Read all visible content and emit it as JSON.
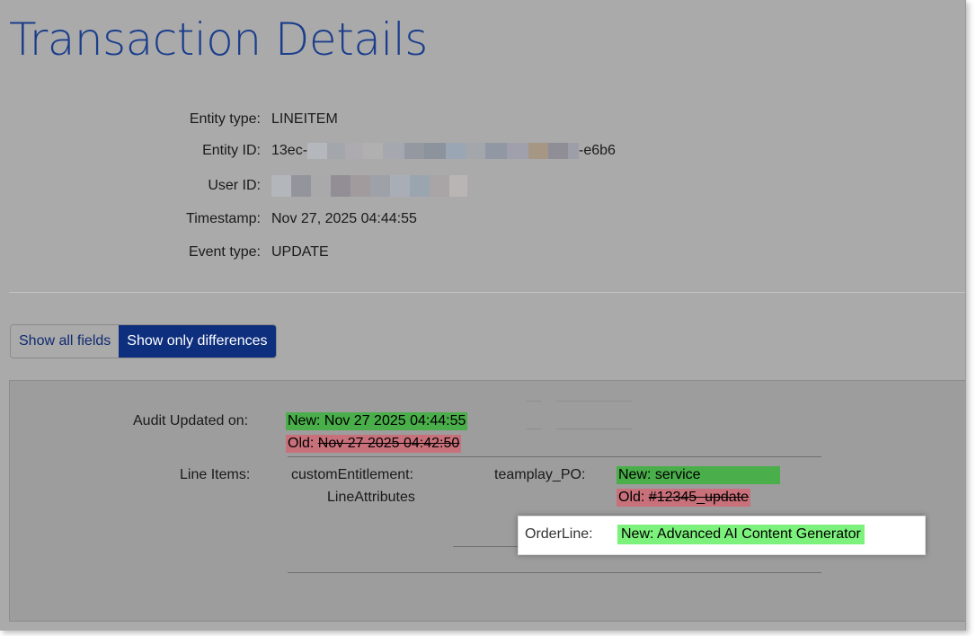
{
  "page": {
    "title": "Transaction Details"
  },
  "metadata": {
    "entity_type_label": "Entity type:",
    "entity_type_value": "LINEITEM",
    "entity_id_label": "Entity ID:",
    "entity_id_prefix": "13ec-",
    "entity_id_suffix": "-e6b6",
    "user_id_label": "User ID:",
    "timestamp_label": "Timestamp:",
    "timestamp_value": "Nov 27, 2025 04:44:55",
    "event_type_label": "Event type:",
    "event_type_value": "UPDATE"
  },
  "view_toggle": {
    "show_all_label": "Show all fields",
    "show_differences_label": "Show only differences",
    "selected": "Show only differences"
  },
  "diff": {
    "audit_updated": {
      "label": "Audit Updated on:",
      "new_value": "New: Nov 27 2025 04:44:55",
      "old_prefix": "Old: ",
      "old_value": "Nov 27 2025 04:42:50"
    },
    "line_items": {
      "label": "Line Items:",
      "group_line1": "customEntitlement:",
      "group_line2": "LineAttributes",
      "teamplay_po": {
        "label": "teamplay_PO:",
        "new_value": "New: service",
        "old_prefix": "Old: ",
        "old_value": "#12345_update"
      },
      "order_line": {
        "label": "OrderLine:",
        "new_value": "New: Advanced AI Content Generator"
      }
    }
  },
  "colors": {
    "title": "#1a3d8c",
    "toggle_selected_bg": "#0e2f7e",
    "new_highlight": "#4aae4a",
    "old_highlight": "#c9717b",
    "popout_new_highlight": "#7cf27c"
  }
}
